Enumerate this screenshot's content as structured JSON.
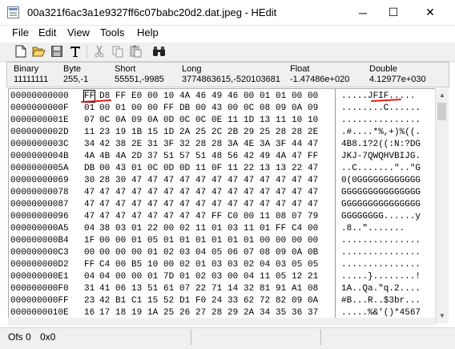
{
  "window": {
    "title": "00a321f6ac3a1e9327ff6c07babc20d2.dat.jpeg - HEdit",
    "minimize": "─",
    "maximize": "☐",
    "close": "✕"
  },
  "menu": [
    "File",
    "Edit",
    "View",
    "Tools",
    "Help"
  ],
  "toolbar_icons": [
    "new-file-icon",
    "open-folder-icon",
    "save-icon",
    "text-mode-icon",
    "cut-icon",
    "copy-icon",
    "paste-icon",
    "find-icon"
  ],
  "info": {
    "binary_label": "Binary",
    "binary_value": "11111111",
    "byte_label": "Byte",
    "byte_value": "255,-1",
    "short_label": "Short",
    "short_value": "55551,-9985",
    "long_label": "Long",
    "long_value": "3774863615,-520103681",
    "float_label": "Float",
    "float_value": "-1.47486e+020",
    "double_label": "Double",
    "double_value": "4.12977e+030"
  },
  "hex_rows": [
    {
      "offset": "00000000000",
      "bytes": "FF D8 FF E0 00 10 4A 46 49 46 00 01 01 00 00",
      "ascii": ".....JFIF....."
    },
    {
      "offset": "0000000000F",
      "bytes": "01 00 01 00 00 FF DB 00 43 00 0C 08 09 0A 09",
      "ascii": "........C......"
    },
    {
      "offset": "0000000001E",
      "bytes": "07 0C 0A 09 0A 0D 0C 0C 0E 11 1D 13 11 10 10",
      "ascii": "..............."
    },
    {
      "offset": "0000000002D",
      "bytes": "11 23 19 1B 15 1D 2A 25 2C 2B 29 25 28 28 2E",
      "ascii": ".#....*%,+)%((."
    },
    {
      "offset": "0000000003C",
      "bytes": "34 42 38 2E 31 3F 32 28 28 3A 4E 3A 3F 44 47",
      "ascii": "4B8.1?2((:N:?DG"
    },
    {
      "offset": "0000000004B",
      "bytes": "4A 4B 4A 2D 37 51 57 51 48 56 42 49 4A 47 FF",
      "ascii": "JKJ-7QWQHVBIJG."
    },
    {
      "offset": "0000000005A",
      "bytes": "DB 00 43 01 0C 0D 0D 11 0F 11 22 13 13 22 47",
      "ascii": "..C.......\"..\"G"
    },
    {
      "offset": "00000000069",
      "bytes": "30 28 30 47 47 47 47 47 47 47 47 47 47 47 47",
      "ascii": "0(0GGGGGGGGGGGG"
    },
    {
      "offset": "00000000078",
      "bytes": "47 47 47 47 47 47 47 47 47 47 47 47 47 47 47",
      "ascii": "GGGGGGGGGGGGGGG"
    },
    {
      "offset": "00000000087",
      "bytes": "47 47 47 47 47 47 47 47 47 47 47 47 47 47 47",
      "ascii": "GGGGGGGGGGGGGGG"
    },
    {
      "offset": "00000000096",
      "bytes": "47 47 47 47 47 47 47 47 FF C0 00 11 08 07 79",
      "ascii": "GGGGGGGG......y"
    },
    {
      "offset": "000000000A5",
      "bytes": "04 38 03 01 22 00 02 11 01 03 11 01 FF C4 00",
      "ascii": ".8..\"......."
    },
    {
      "offset": "000000000B4",
      "bytes": "1F 00 00 01 05 01 01 01 01 01 01 00 00 00 00",
      "ascii": "..............."
    },
    {
      "offset": "000000000C3",
      "bytes": "00 00 00 00 01 02 03 04 05 06 07 08 09 0A 0B",
      "ascii": "..............."
    },
    {
      "offset": "000000000D2",
      "bytes": "FF C4 00 B5 10 00 02 01 03 03 02 04 03 05 05",
      "ascii": "..............."
    },
    {
      "offset": "000000000E1",
      "bytes": "04 04 00 00 01 7D 01 02 03 00 04 11 05 12 21",
      "ascii": ".....}........!"
    },
    {
      "offset": "000000000F0",
      "bytes": "31 41 06 13 51 61 07 22 71 14 32 81 91 A1 08",
      "ascii": "1A..Qa.\"q.2...."
    },
    {
      "offset": "000000000FF",
      "bytes": "23 42 B1 C1 15 52 D1 F0 24 33 62 72 82 09 0A",
      "ascii": "#B...R..$3br..."
    },
    {
      "offset": "0000000010E",
      "bytes": "16 17 18 19 1A 25 26 27 28 29 2A 34 35 36 37",
      "ascii": ".....%&'()*4567"
    }
  ],
  "status": {
    "ofs_label": "Ofs 0",
    "ofs_hex": "0x0"
  }
}
